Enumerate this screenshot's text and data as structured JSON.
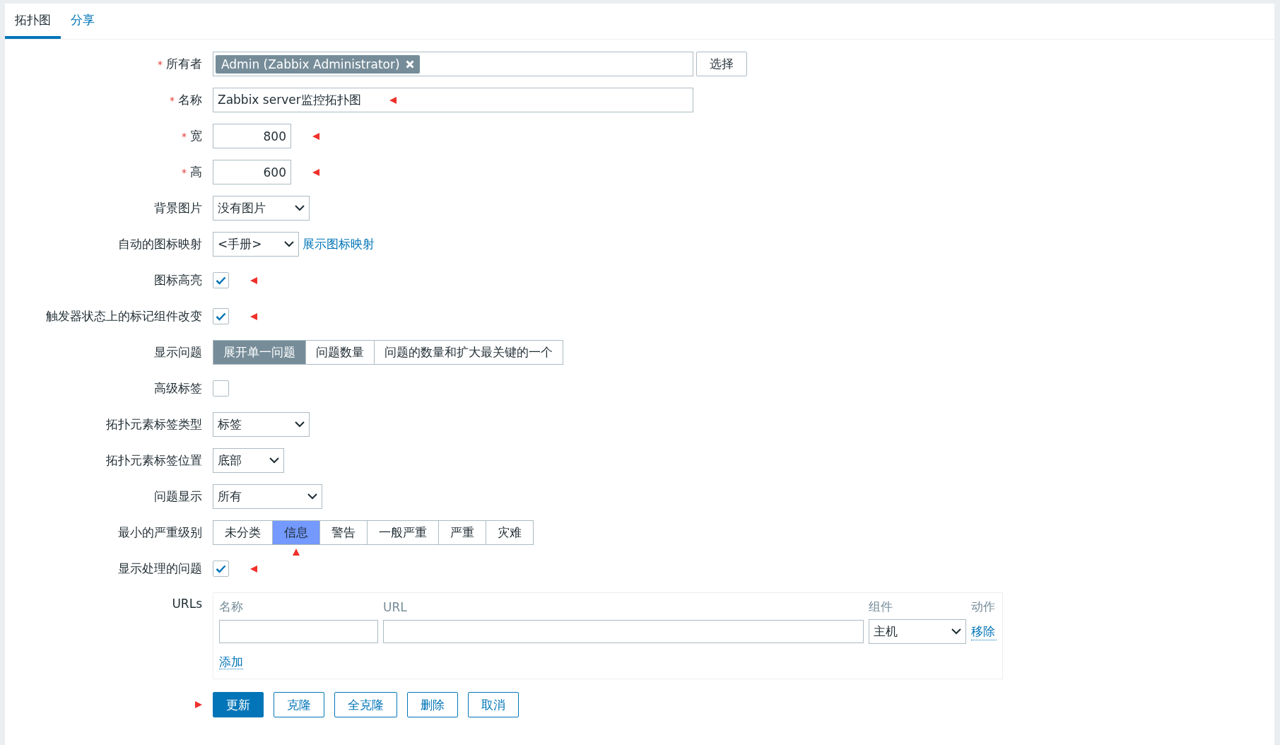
{
  "tabs": [
    {
      "label": "拓扑图",
      "selected": true
    },
    {
      "label": "分享",
      "selected": false
    }
  ],
  "required_sign": "*",
  "rows": [
    {
      "kind": "multiselect",
      "label": "所有者",
      "required": true,
      "tags": [
        "Admin (Zabbix Administrator)"
      ],
      "button": "选择"
    },
    {
      "kind": "text",
      "label": "名称",
      "required": true,
      "value": "Zabbix server监控拓扑图",
      "annotated": true
    },
    {
      "kind": "number",
      "label": "宽",
      "required": true,
      "value": "800",
      "annotated": true
    },
    {
      "kind": "number",
      "label": "高",
      "required": true,
      "value": "600",
      "annotated": true
    },
    {
      "kind": "select",
      "label": "背景图片",
      "required": false,
      "value": "没有图片"
    },
    {
      "kind": "select",
      "label": "自动的图标映射",
      "required": false,
      "value": "<手册>",
      "link": "展示图标映射"
    },
    {
      "kind": "checkbox",
      "label": "图标高亮",
      "required": false,
      "checked": true,
      "annotated": true
    },
    {
      "kind": "checkbox",
      "label": "触发器状态上的标记组件改变",
      "required": false,
      "checked": true,
      "annotated": true
    },
    {
      "kind": "segmented",
      "label": "显示问题",
      "required": false,
      "options": [
        {
          "label": "展开单一问题",
          "selected": true
        },
        {
          "label": "问题数量",
          "selected": false
        },
        {
          "label": "问题的数量和扩大最关键的一个",
          "selected": false
        }
      ]
    },
    {
      "kind": "checkbox",
      "label": "高级标签",
      "required": false,
      "checked": false
    },
    {
      "kind": "select",
      "label": "拓扑元素标签类型",
      "required": false,
      "value": "标签"
    },
    {
      "kind": "select",
      "label": "拓扑元素标签位置",
      "required": false,
      "value": "底部"
    },
    {
      "kind": "select",
      "label": "问题显示",
      "required": false,
      "value": "所有"
    },
    {
      "kind": "segmented",
      "label": "最小的严重级别",
      "required": false,
      "annotated": true,
      "options": [
        {
          "label": "未分类",
          "selected": false
        },
        {
          "label": "信息",
          "selected": true
        },
        {
          "label": "警告",
          "selected": false
        },
        {
          "label": "一般严重",
          "selected": false
        },
        {
          "label": "严重",
          "selected": false
        },
        {
          "label": "灾难",
          "selected": false
        }
      ]
    },
    {
      "kind": "checkbox",
      "label": "显示处理的问题",
      "required": false,
      "checked": true,
      "annotated": true
    },
    {
      "kind": "urls",
      "label": "URLs",
      "required": false,
      "columns": [
        "名称",
        "URL",
        "组件",
        "动作"
      ],
      "entries": [
        {
          "component": "主机",
          "action": "移除"
        }
      ],
      "add": "添加"
    }
  ],
  "buttons": [
    {
      "label": "更新",
      "primary": true
    },
    {
      "label": "克隆",
      "primary": false
    },
    {
      "label": "全克隆",
      "primary": false
    },
    {
      "label": "删除",
      "primary": false
    },
    {
      "label": "取消",
      "primary": false
    }
  ],
  "buttons_annotated": true
}
